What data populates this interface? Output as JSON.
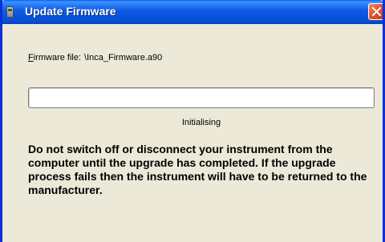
{
  "window": {
    "title": "Update Firmware",
    "title_icon": "instrument-icon",
    "close_icon": "close-icon",
    "colors": {
      "titlebar": "#0a54dc",
      "close_button": "#e2562e",
      "background": "#ece9d8"
    }
  },
  "firmware": {
    "label_underlined_char": "F",
    "label_rest": "irmware file:",
    "value": "\\Inca_Firmware.a90"
  },
  "progress": {
    "percent": 0,
    "status": "Initialising"
  },
  "warning": "Do not switch off or disconnect your instrument from the computer until the upgrade has completed. If the upgrade process fails then the instrument will have to be returned to the manufacturer."
}
